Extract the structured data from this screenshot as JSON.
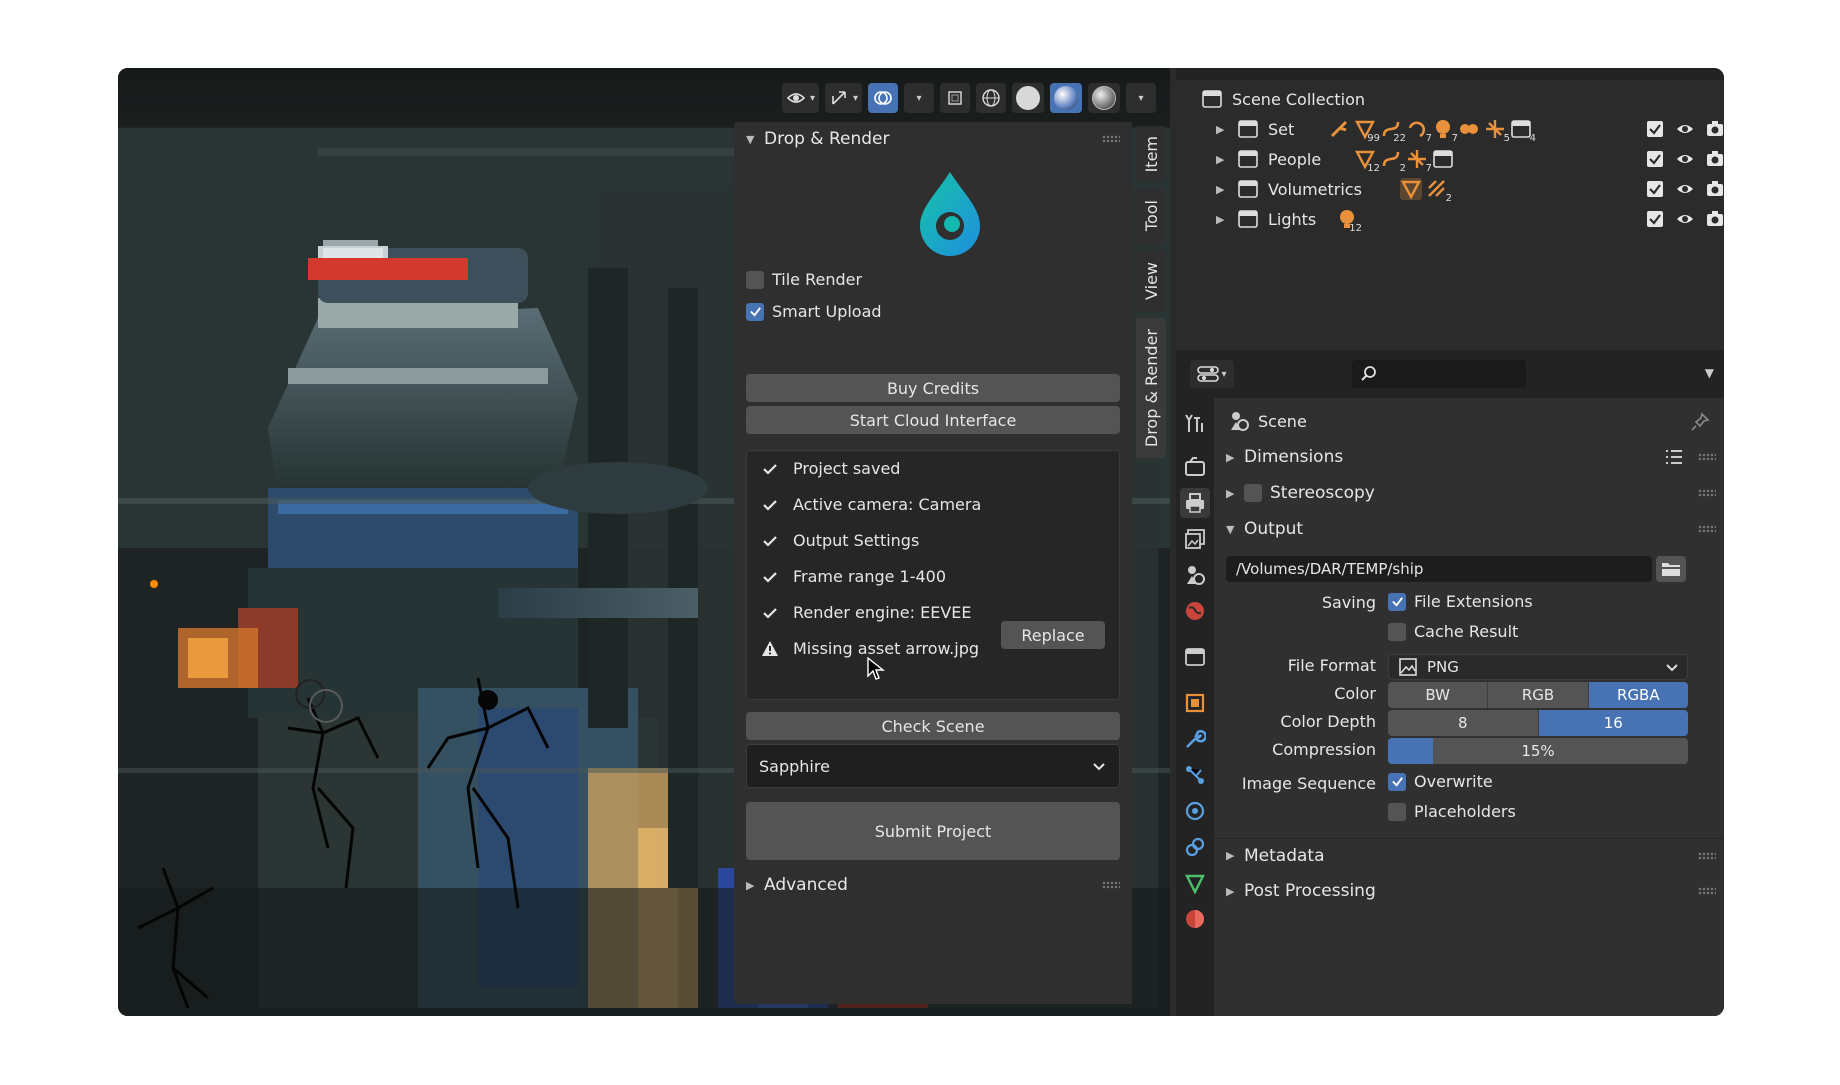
{
  "drop_panel": {
    "title": "Drop & Render",
    "tile_render": {
      "label": "Tile Render",
      "checked": false
    },
    "smart_upload": {
      "label": "Smart Upload",
      "checked": true
    },
    "buy_credits": "Buy Credits",
    "start_cloud": "Start Cloud Interface",
    "checklist": [
      {
        "label": "Project saved",
        "status": "ok"
      },
      {
        "label": "Active camera: Camera",
        "status": "ok"
      },
      {
        "label": "Output Settings",
        "status": "ok"
      },
      {
        "label": "Frame range 1-400",
        "status": "ok"
      },
      {
        "label": "Render engine: EEVEE",
        "status": "ok"
      },
      {
        "label": "Missing asset arrow.jpg",
        "status": "warning"
      }
    ],
    "replace": "Replace",
    "check_scene": "Check Scene",
    "preset": "Sapphire",
    "submit": "Submit Project",
    "advanced": "Advanced",
    "accent_color": "#1fb8c9"
  },
  "npanel_tabs": [
    "Item",
    "Tool",
    "View",
    "Drop & Render"
  ],
  "outliner": {
    "root": "Scene Collection",
    "collections": [
      {
        "name": "Set",
        "counts": [
          "",
          "99",
          "22",
          "7",
          "7",
          "",
          "5",
          "4"
        ]
      },
      {
        "name": "People",
        "counts": [
          "12",
          "2",
          "7",
          ""
        ]
      },
      {
        "name": "Volumetrics",
        "counts": [
          "",
          "2"
        ]
      },
      {
        "name": "Lights",
        "counts": [
          "12"
        ]
      }
    ]
  },
  "properties": {
    "context": "Scene",
    "sections": {
      "dimensions": "Dimensions",
      "stereoscopy": "Stereoscopy",
      "output": "Output",
      "metadata": "Metadata",
      "post_processing": "Post Processing"
    },
    "output_path": "/Volumes/DAR/TEMP/ship",
    "saving_label": "Saving",
    "file_extensions": "File Extensions",
    "cache_result": "Cache Result",
    "file_format_label": "File Format",
    "file_format": "PNG",
    "color_label": "Color",
    "color_options": [
      "BW",
      "RGB",
      "RGBA"
    ],
    "color_selected": "RGBA",
    "color_depth_label": "Color Depth",
    "color_depth_options": [
      "8",
      "16"
    ],
    "color_depth_selected": "16",
    "compression_label": "Compression",
    "compression_value": "15%",
    "compression_fraction": 0.15,
    "image_sequence_label": "Image Sequence",
    "overwrite": "Overwrite",
    "placeholders": "Placeholders"
  },
  "colors": {
    "accent": "#4772b3",
    "object_orange": "#e8913a"
  }
}
